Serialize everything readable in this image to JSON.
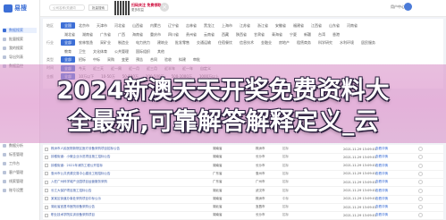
{
  "brand": {
    "name": "易搜"
  },
  "sidebar": {
    "items": [
      {
        "label": "数据搜索"
      },
      {
        "label": "批量搜索"
      },
      {
        "label": "我的搜索"
      },
      {
        "label": "导出列表"
      },
      {
        "label": "数据监控"
      },
      {
        "label": "数据分析"
      },
      {
        "label": "标签管理"
      },
      {
        "label": "工作台"
      },
      {
        "label": "客户管理"
      },
      {
        "label": "线索管理"
      },
      {
        "label": "账号设置"
      }
    ]
  },
  "topbar": {
    "search_placeholder": "公司名称/关键词",
    "btn_batch": "批量搜索",
    "btn_export": "导出",
    "promo_line1": "扫码关注 免费领取",
    "promo_line2": "更多权益",
    "close": "×",
    "user_name": "用户中心"
  },
  "filters": [
    {
      "label": "地区",
      "chips": [
        "全国",
        "北京市",
        "天津市",
        "河北省",
        "山西省",
        "内蒙古",
        "辽宁省",
        "吉林省",
        "黑龙江",
        "上海市",
        "江苏省",
        "浙江省",
        "安徽省",
        "福建省",
        "江西省",
        "山东省",
        "河南省"
      ],
      "active": 0
    },
    {
      "label": "",
      "chips": [
        "湖北省",
        "湖南省",
        "广东省",
        "广西",
        "海南省",
        "重庆市",
        "四川省",
        "贵州省",
        "云南省",
        "西藏",
        "陕西省",
        "甘肃省",
        "青海省",
        "宁夏",
        "新疆",
        "台湾",
        "香港"
      ],
      "active": -1
    },
    {
      "label": "行业",
      "chips": [
        "全部",
        "农林牧渔",
        "采矿业",
        "制造业",
        "电力热力",
        "建筑业",
        "批发零售",
        "交通运输",
        "住宿餐饮",
        "信息技术",
        "金融业",
        "房地产",
        "租赁商务",
        "科学研究",
        "水利环境",
        "居民服务"
      ],
      "active": 0
    },
    {
      "label": "",
      "chips": [
        "教育",
        "卫生",
        "文化体育",
        "公共管理",
        "国际组织",
        "其他"
      ],
      "active": -1
    },
    {
      "label": "类型",
      "chips": [
        "全部",
        "招标",
        "中标",
        "采购",
        "变更",
        "预告",
        "合同",
        "验收",
        "拟建",
        "审批"
      ],
      "active": 0
    },
    {
      "label": "时间",
      "chips": [
        "全部",
        "今天",
        "近三天",
        "近一周",
        "近一月",
        "近三月",
        "近半年",
        "近一年",
        "自定义"
      ],
      "active": 0
    },
    {
      "label": "金额",
      "chips": [
        "全部",
        "10万以下",
        "10-50万",
        "50-100万",
        "100-500万",
        "500-1000万",
        "1000万以上"
      ],
      "active": 0
    }
  ],
  "overlay": {
    "line1": "2024新澳天天开奖免费资料大",
    "line2": "全最新,可靠解答解释定义_云"
  },
  "rows": [
    {
      "title": "株洲市人民医院新院区医疗设备采购项目招标公告",
      "site": "湖南省",
      "region": "株洲市",
      "tag": "招标",
      "date": "2021-11-29 13:09:01",
      "ops": "查看详情"
    },
    {
      "title": "钟楼街道：小微企业示范项目施工招标公告",
      "site": "湖南省",
      "region": "长沙市",
      "tag": "招标",
      "date": "2021-11-29 13:09:01",
      "ops": "查看详情"
    },
    {
      "title": "钟楼街道：2021年消防工程公开招标",
      "site": "湖南省",
      "region": "长沙市",
      "tag": "招标",
      "date": "2021-11-29 13:09:01",
      "ops": "查看详情"
    },
    {
      "title": "惠州市公共资源交易中心建设工程招标公告",
      "site": "广东省",
      "region": "惠州市",
      "tag": "招标",
      "date": "2021-11-29 13:09:01",
      "ops": "查看详情"
    },
    {
      "title": "入驻广州科学城产业园项目运营服务采购",
      "site": "广东省",
      "region": "广州市",
      "tag": "招标",
      "date": "2021-11-29 13:09:01",
      "ops": "查看详情"
    },
    {
      "title": "长江大保护项目施工招标公告",
      "site": "湖北省",
      "region": "武汉市",
      "tag": "招标",
      "date": "2021-11-29 13:09:01",
      "ops": "查看详情"
    },
    {
      "title": "某某区街道办事处采购项目中标公示",
      "site": "湖南省",
      "region": "株洲市",
      "tag": "中标",
      "date": "2021-11-29 13:09:01",
      "ops": "查看详情"
    },
    {
      "title": "湖北省宜昌市医院设备采购公告",
      "site": "湖北省",
      "region": "宜昌市",
      "tag": "招标",
      "date": "2021-11-29 13:09:01",
      "ops": "查看详情"
    },
    {
      "title": "职业技术学院实训设备采购项目",
      "site": "湖南省",
      "region": "长沙市",
      "tag": "招标",
      "date": "2021-11-29 13:09:01",
      "ops": "查看详情"
    }
  ]
}
